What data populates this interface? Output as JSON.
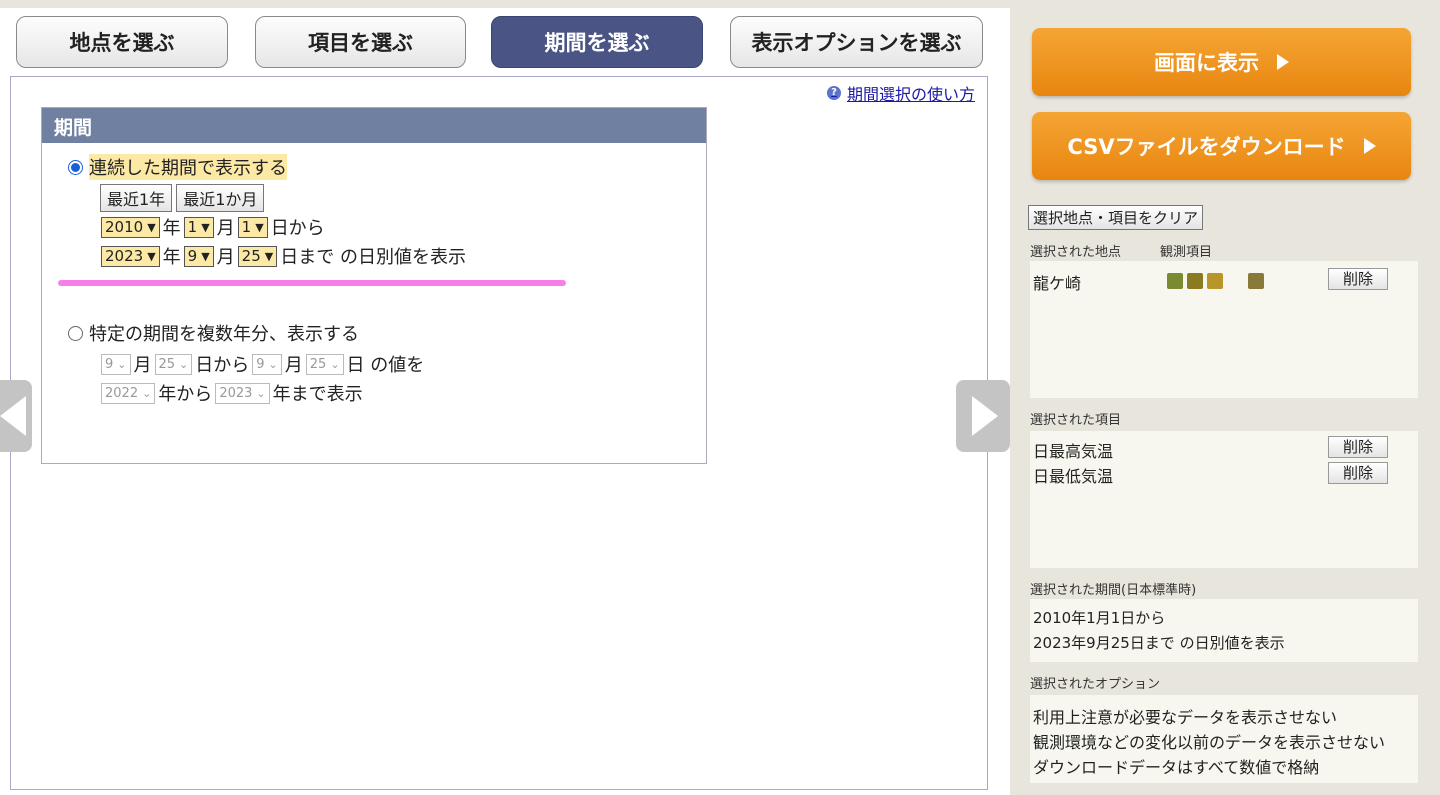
{
  "tabs": {
    "location": "地点を選ぶ",
    "item": "項目を選ぶ",
    "period": "期間を選ぶ",
    "options": "表示オプションを選ぶ"
  },
  "help_link": "期間選択の使い方",
  "period": {
    "heading": "期間",
    "continuous": {
      "label": "連続した期間で表示する",
      "recent_year_btn": "最近1年",
      "recent_month_btn": "最近1か月",
      "from_year": "2010",
      "from_month": "1",
      "from_day": "1",
      "to_year": "2023",
      "to_month": "9",
      "to_day": "25",
      "unit_year": "年",
      "unit_month": "月",
      "from_suffix": "日から",
      "to_suffix": "日まで の日別値を表示"
    },
    "multi_year": {
      "label": "特定の期間を複数年分、表示する",
      "month1": "9",
      "day1": "25",
      "month2": "9",
      "day2": "25",
      "year_from": "2022",
      "year_to": "2023",
      "text_month": "月",
      "text_day_from": "日から",
      "text_day_values": "日 の値を",
      "text_year_from": "年から",
      "text_year_to": "年まで表示"
    }
  },
  "sidebar": {
    "show_button": "画面に表示",
    "csv_button": "CSVファイルをダウンロード",
    "clear_button": "選択地点・項目をクリア",
    "selected_location_label": "選択された地点",
    "observation_label": "観測項目",
    "location_name": "龍ケ崎",
    "delete_label": "削除",
    "selected_items_label": "選択された項目",
    "items": [
      "日最高気温",
      "日最低気温"
    ],
    "selected_period_label": "選択された期間(日本標準時)",
    "period_line1": "2010年1月1日から",
    "period_line2": "2023年9月25日まで の日別値を表示",
    "selected_options_label": "選択されたオプション",
    "options": [
      "利用上注意が必要なデータを表示させない",
      "観測環境などの変化以前のデータを表示させない",
      "ダウンロードデータはすべて数値で格納"
    ]
  },
  "colors": {
    "active_tab": "#4a5585",
    "header_bar": "#7080a0",
    "orange_button": "#e8860f",
    "highlight": "#fde9a6",
    "pink_underline": "#f77ee8"
  }
}
